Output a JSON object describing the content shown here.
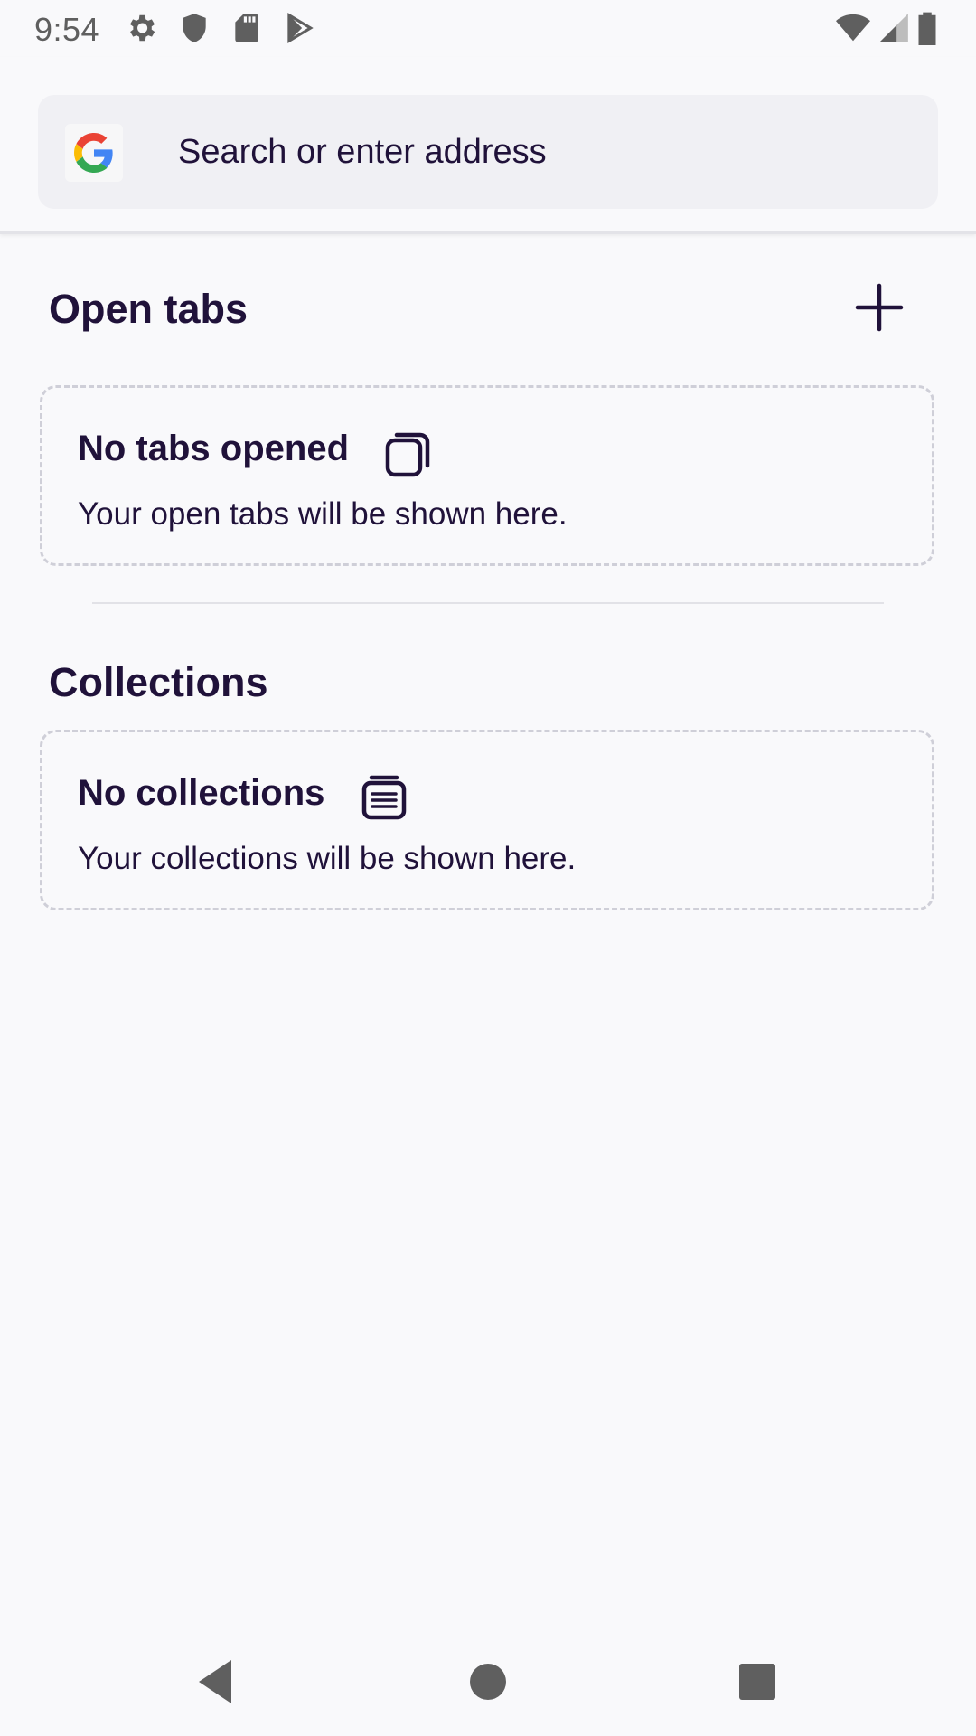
{
  "status_bar": {
    "time": "9:54",
    "left_icons": [
      "settings-icon",
      "shield-icon",
      "sd-card-icon",
      "play-store-icon"
    ],
    "right_icons": [
      "wifi-icon",
      "cell-signal-icon",
      "battery-icon"
    ]
  },
  "toolbar": {
    "search_placeholder": "Search or enter address",
    "search_engine_icon": "google-logo-icon"
  },
  "open_tabs": {
    "title": "Open tabs",
    "add_icon": "plus-icon",
    "empty_title": "No tabs opened",
    "empty_icon": "tabs-icon",
    "empty_description": "Your open tabs will be shown here."
  },
  "collections": {
    "title": "Collections",
    "empty_title": "No collections",
    "empty_icon": "collection-icon",
    "empty_description": "Your collections will be shown here."
  },
  "nav_bar": {
    "icons": [
      "back-icon",
      "home-icon",
      "recents-icon"
    ]
  },
  "colors": {
    "background": "#f9f9fb",
    "text_primary": "#20123a",
    "search_box": "#f0f0f4",
    "dashed_border": "#cfcfd8"
  }
}
